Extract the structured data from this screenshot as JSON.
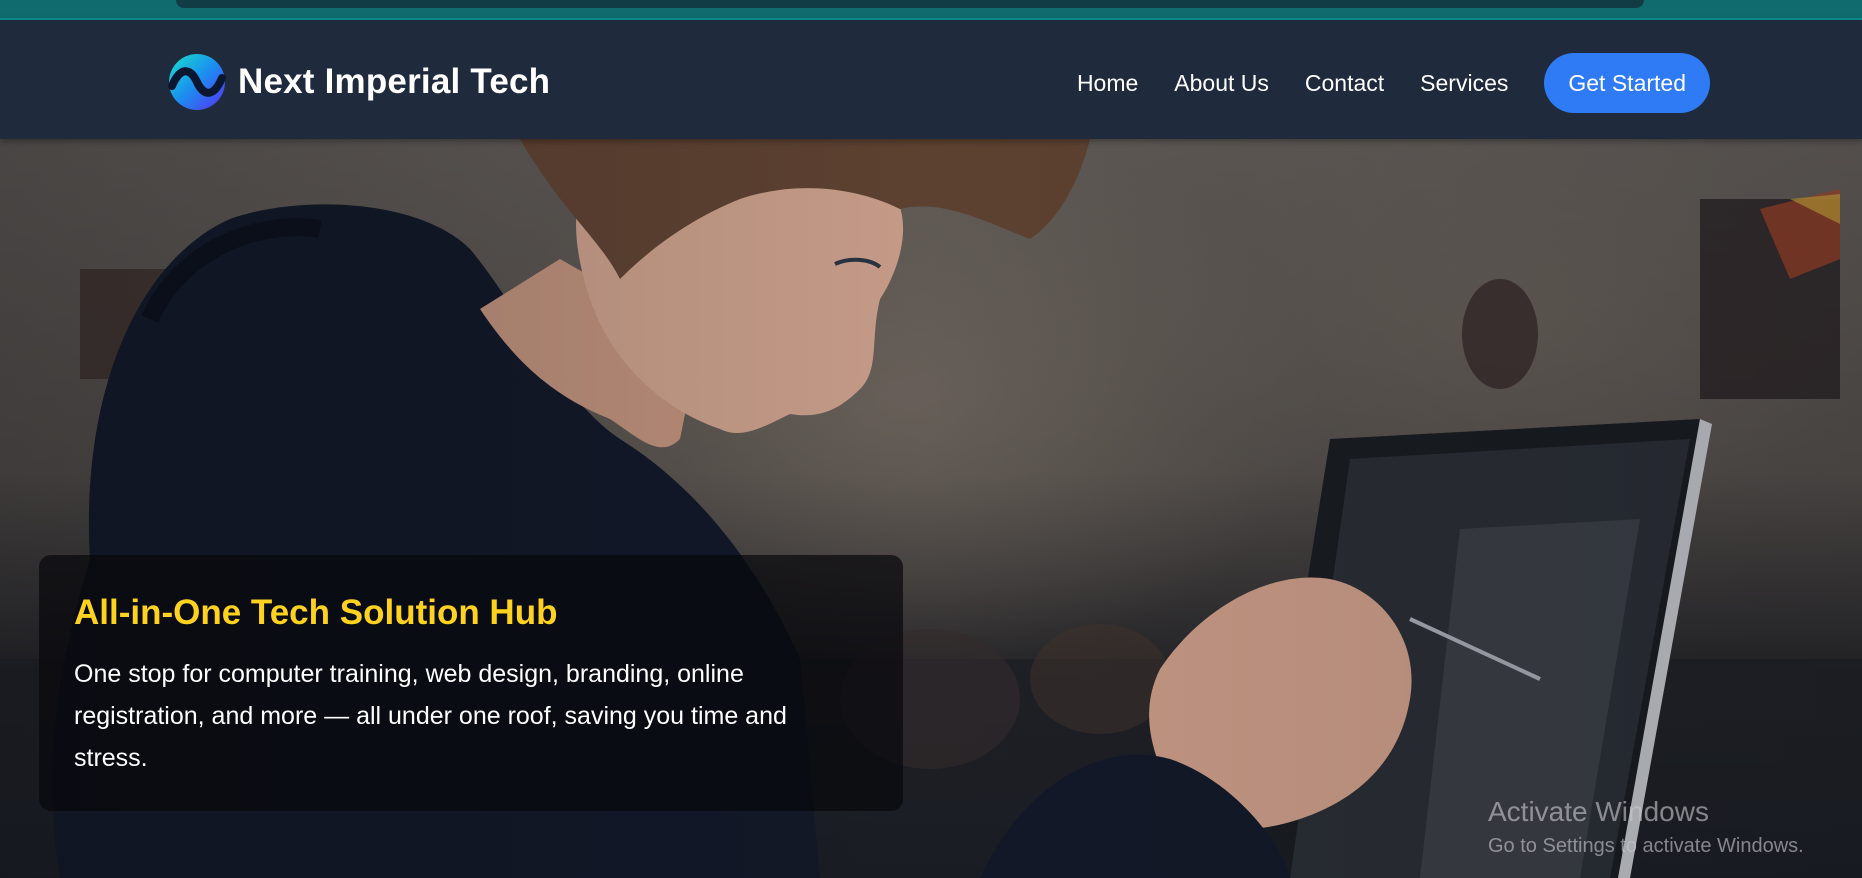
{
  "brand": {
    "name": "Next Imperial Tech"
  },
  "nav": {
    "links": [
      "Home",
      "About Us",
      "Contact",
      "Services"
    ],
    "cta": "Get Started"
  },
  "hero": {
    "title": "All-in-One Tech Solution Hub",
    "text": "One stop for computer training, web design, branding, online registration, and more — all under one roof, saving you time and stress."
  },
  "watermark": {
    "title": "Activate Windows",
    "subtitle": "Go to Settings to activate Windows."
  },
  "colors": {
    "navbar": "#1f2a3d",
    "accent": "#2f7bf5",
    "hero_title": "#ffd21f",
    "top_strip": "#0f6b6e"
  },
  "icons": {
    "logo": "wave-logo-icon"
  }
}
